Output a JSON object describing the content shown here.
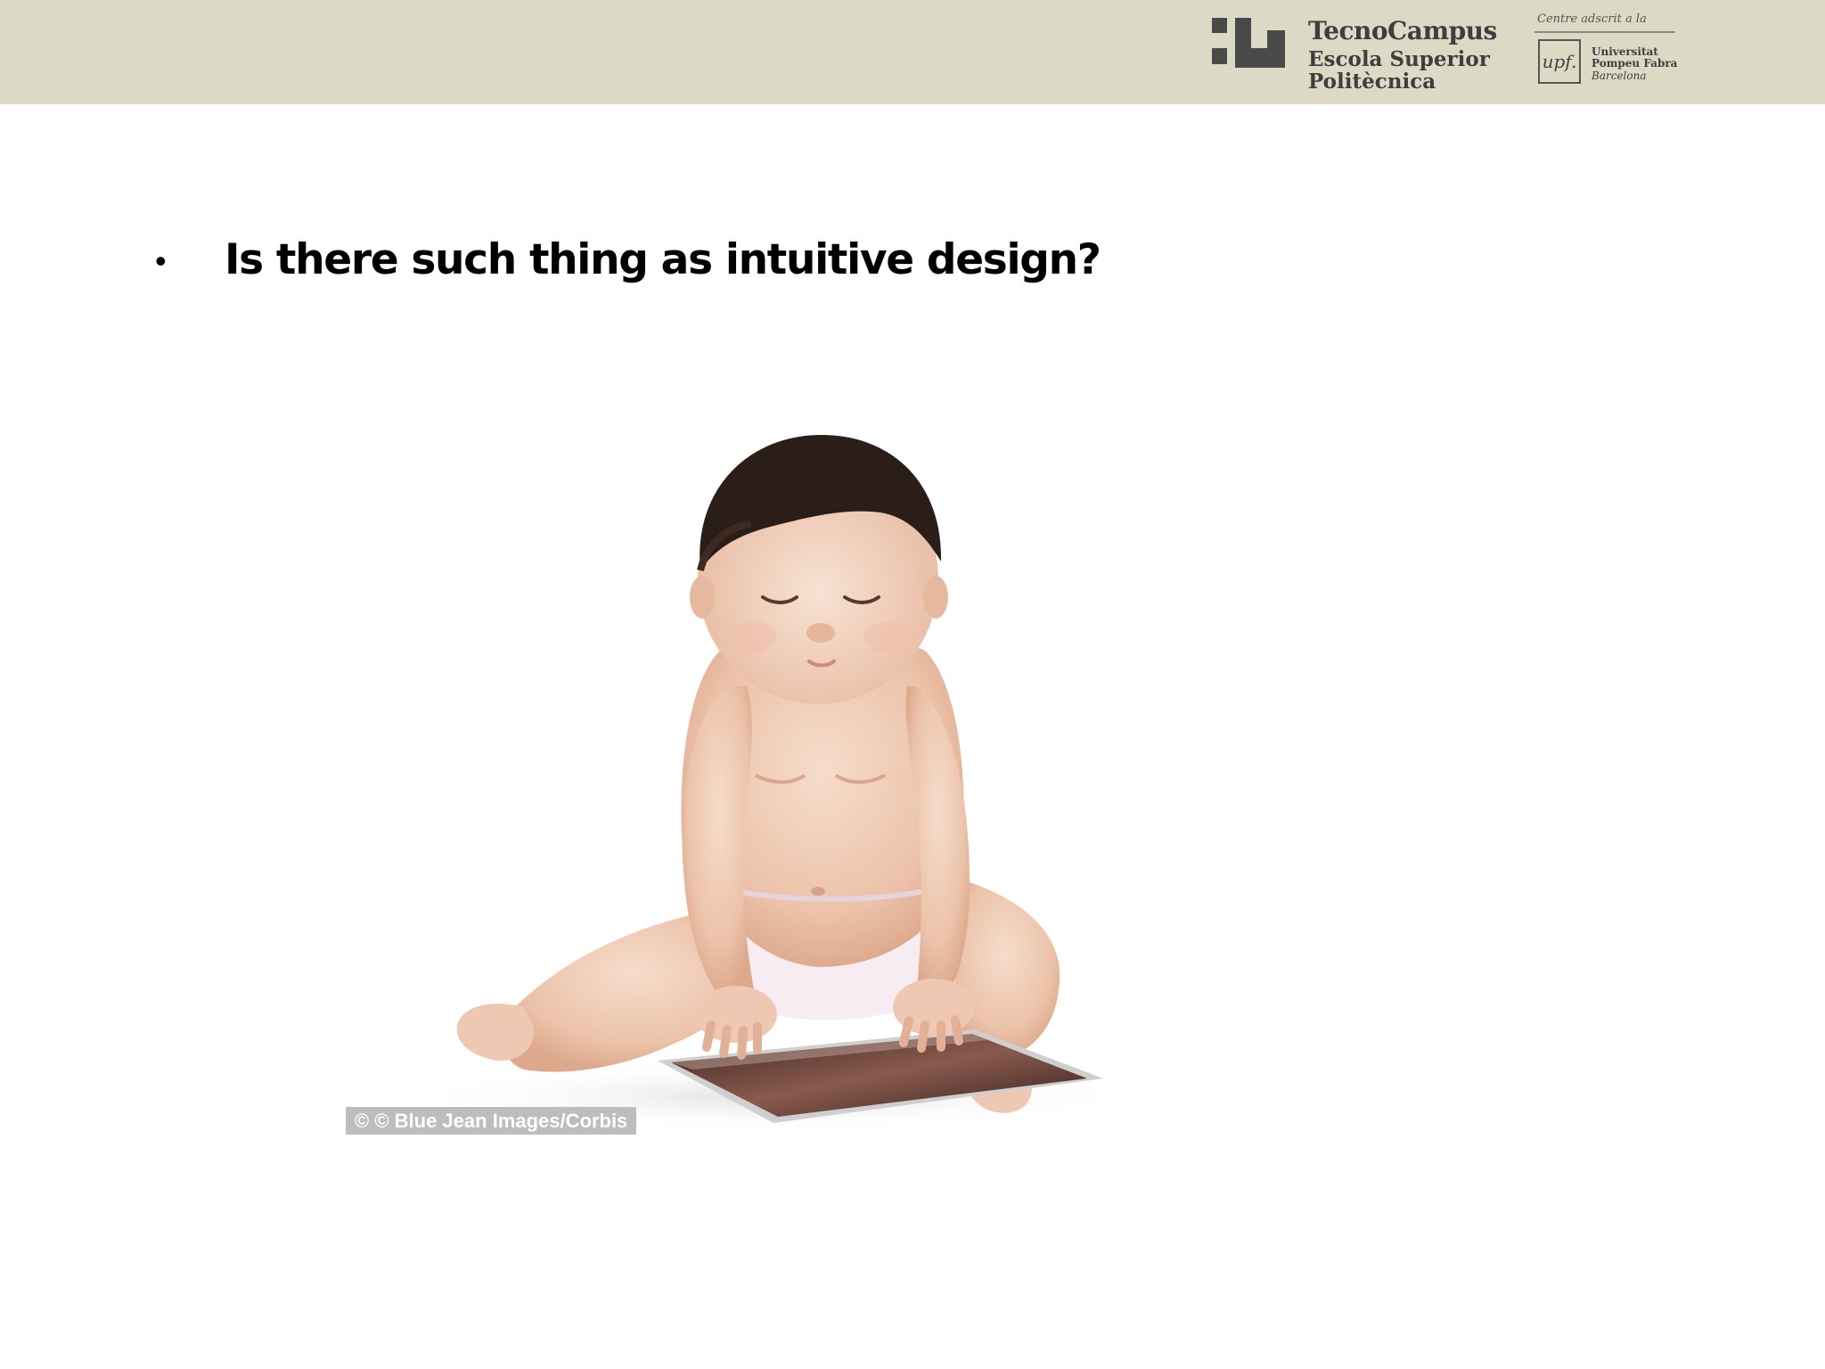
{
  "header": {
    "band_color": "#dcd9c4",
    "tecnocampus": {
      "name": "TecnoCampus",
      "line2": "Escola Superior",
      "line3": "Politècnica"
    },
    "upf": {
      "caption": "Centre adscrit a la",
      "mark": "upf.",
      "line1": "Universitat",
      "line2": "Pompeu Fabra",
      "line3": "Barcelona"
    }
  },
  "content": {
    "bullet_symbol": "•",
    "bullet_text": "Is there such thing as intuitive design?"
  },
  "photo": {
    "subject": "baby-with-tablet",
    "credit": "© © Blue Jean Images/Corbis"
  }
}
